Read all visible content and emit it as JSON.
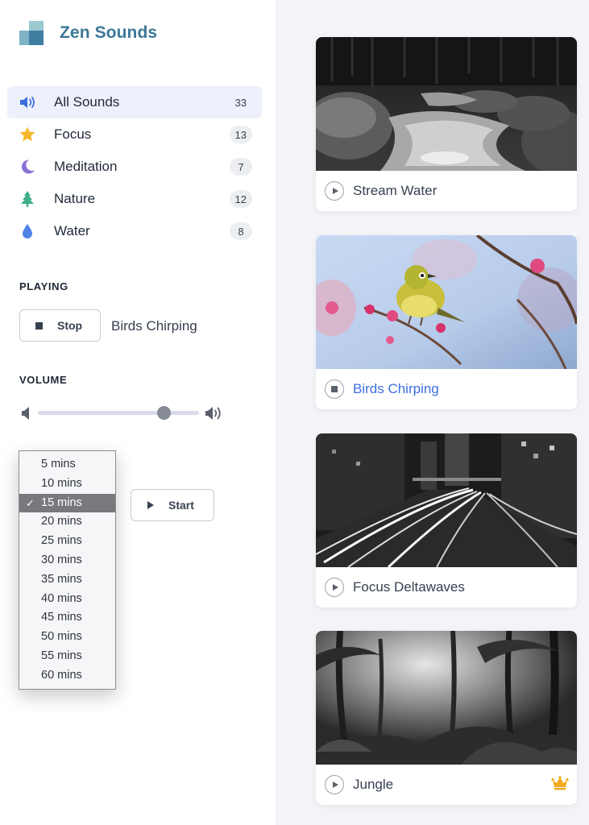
{
  "app": {
    "title": "Zen Sounds"
  },
  "categories": [
    {
      "label": "All Sounds",
      "count": "33",
      "icon": "speaker-icon",
      "color": "#3b6fe0",
      "active": true
    },
    {
      "label": "Focus",
      "count": "13",
      "icon": "star-icon",
      "color": "#f5b72b"
    },
    {
      "label": "Meditation",
      "count": "7",
      "icon": "moon-icon",
      "color": "#8b6fd8"
    },
    {
      "label": "Nature",
      "count": "12",
      "icon": "tree-icon",
      "color": "#3fae8a"
    },
    {
      "label": "Water",
      "count": "8",
      "icon": "droplet-icon",
      "color": "#4e82e8"
    }
  ],
  "playing": {
    "title": "PLAYING",
    "stop_label": "Stop",
    "now_playing": "Birds Chirping"
  },
  "volume": {
    "title": "VOLUME",
    "level": 0.78
  },
  "timer": {
    "options": [
      "5 mins",
      "10 mins",
      "15 mins",
      "20 mins",
      "25 mins",
      "30 mins",
      "35 mins",
      "40 mins",
      "45 mins",
      "50 mins",
      "55 mins",
      "60 mins"
    ],
    "selected": "15 mins",
    "check_mark": "✓",
    "start_label": "Start"
  },
  "sounds": [
    {
      "title": "Stream Water",
      "state": "stopped",
      "premium": false,
      "image": "stream"
    },
    {
      "title": "Birds Chirping",
      "state": "playing",
      "premium": false,
      "image": "bird"
    },
    {
      "title": "Focus Deltawaves",
      "state": "stopped",
      "premium": false,
      "image": "city-lights"
    },
    {
      "title": "Jungle",
      "state": "stopped",
      "premium": true,
      "image": "jungle"
    }
  ]
}
